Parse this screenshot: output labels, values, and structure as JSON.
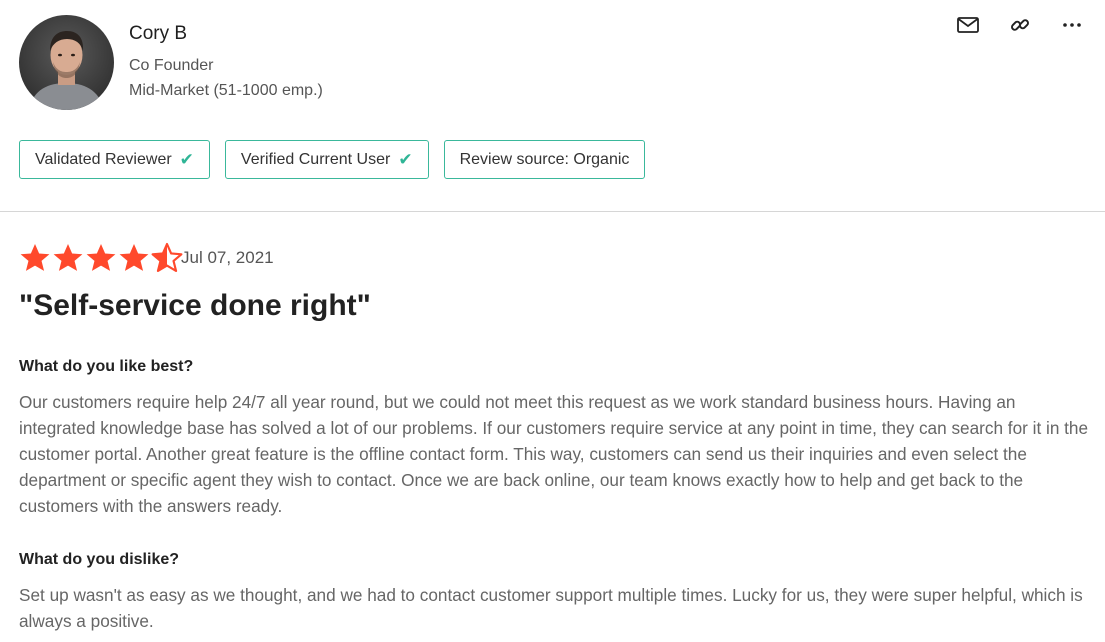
{
  "reviewer": {
    "name": "Cory B",
    "role": "Co Founder",
    "segment": "Mid-Market (51-1000 emp.)"
  },
  "actions": {
    "icons": [
      "mail-icon",
      "link-icon",
      "more-options-icon"
    ]
  },
  "badges": [
    {
      "label": "Validated Reviewer",
      "checked": true
    },
    {
      "label": "Verified Current User",
      "checked": true
    },
    {
      "label": "Review source: Organic",
      "checked": false
    }
  ],
  "review": {
    "rating": 4.5,
    "max_rating": 5,
    "date": "Jul 07, 2021",
    "title": "\"Self-service done right\"",
    "questions": [
      {
        "question": "What do you like best?",
        "answer": "Our customers require help 24/7 all year round, but we could not meet this request as we work standard business hours. Having an integrated knowledge base has solved a lot of our problems. If our customers require service at any point in time, they can search for it in the customer portal. Another great feature is the offline contact form. This way, customers can send us their inquiries and even select the department or specific agent they wish to contact. Once we are back online, our team knows exactly how to help and get back to the customers with the answers ready."
      },
      {
        "question": "What do you dislike?",
        "answer": "Set up wasn't as easy as we thought, and we had to contact customer support multiple times. Lucky for us, they were super helpful, which is always a positive."
      }
    ]
  },
  "colors": {
    "star": "#ff492c",
    "badge_border": "#3ab89b",
    "check": "#2fb596"
  }
}
